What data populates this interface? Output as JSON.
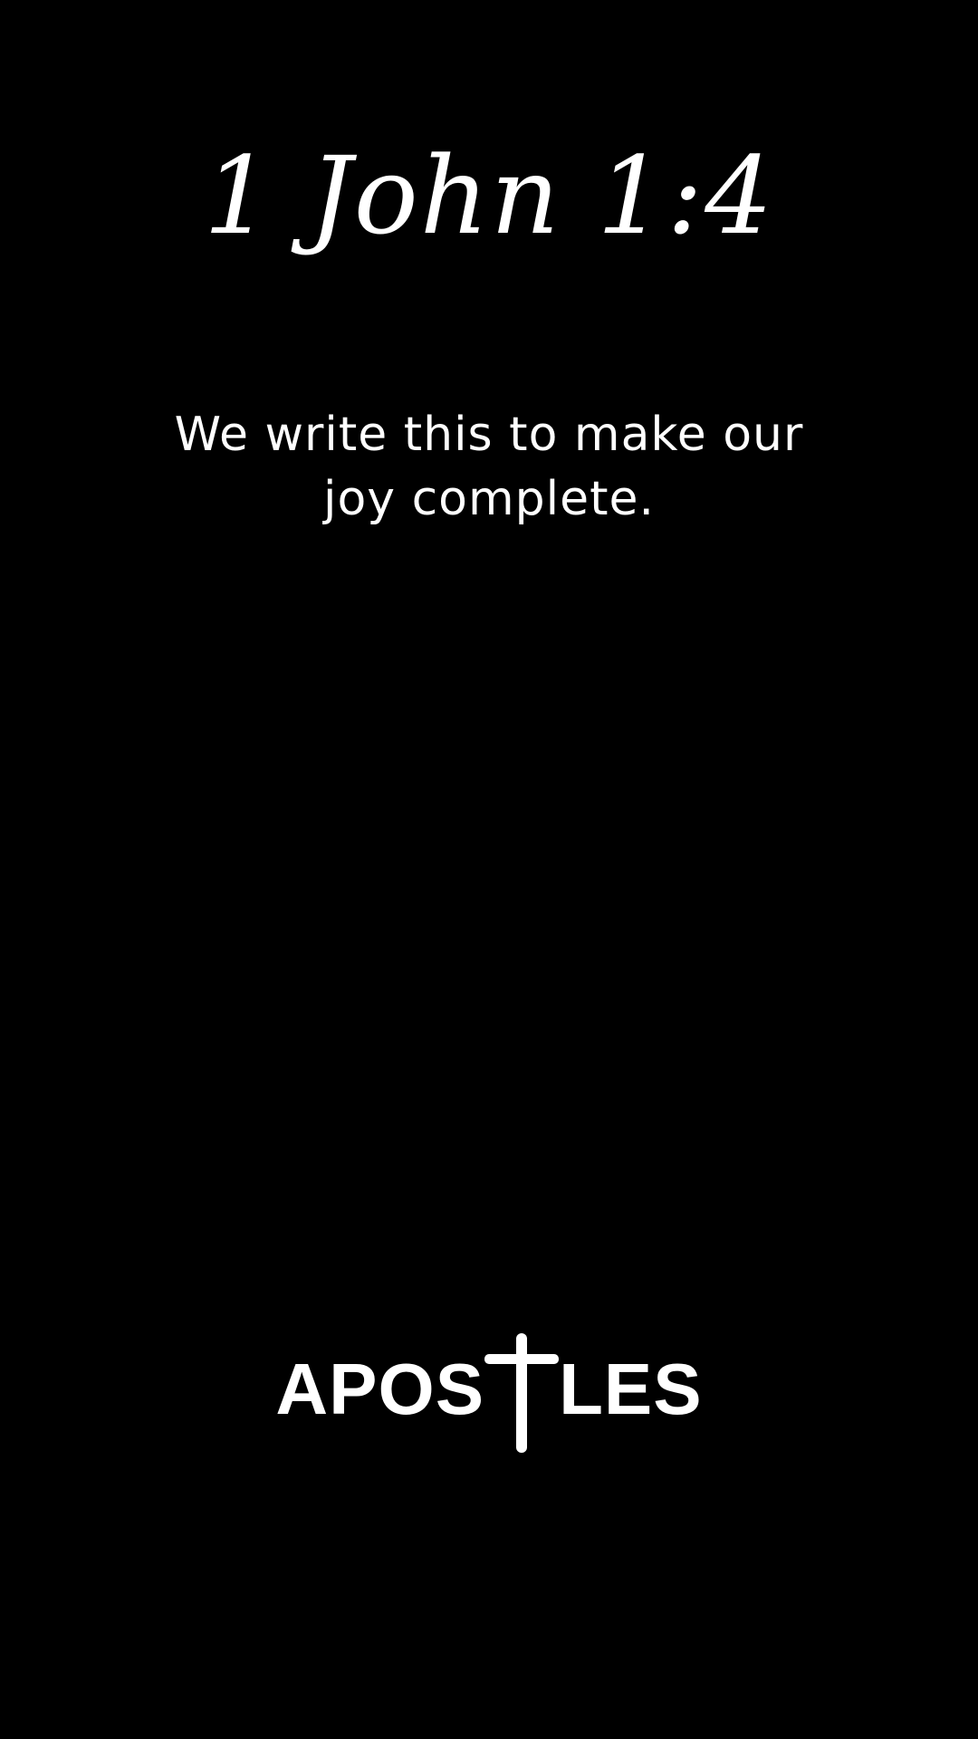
{
  "reference": "1 John 1:4",
  "verse": "We write this to make our joy complete.",
  "logo": {
    "text_before_cross": "APOS",
    "text_after_cross": "LES",
    "icon": "cross-icon",
    "color": "#ffffff"
  },
  "background_color": "#000000"
}
